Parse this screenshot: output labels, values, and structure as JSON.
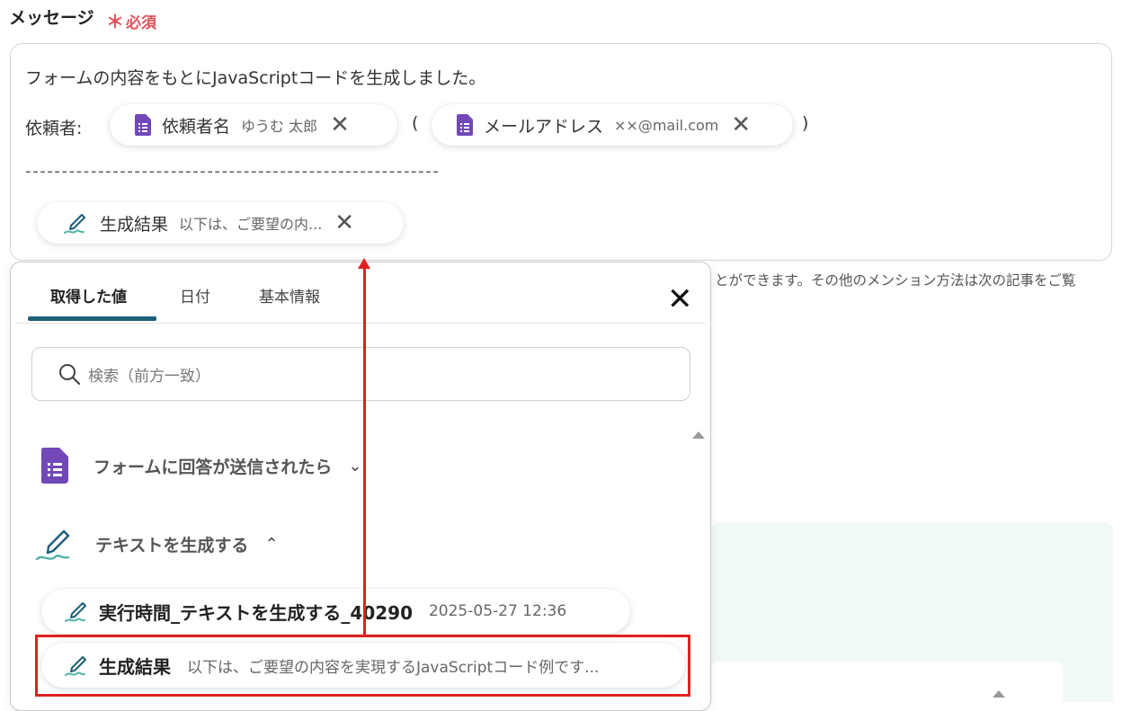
{
  "field": {
    "label": "メッセージ",
    "required_mark": "＊",
    "required_label": "必須"
  },
  "editor": {
    "line1": "フォームの内容をもとにJavaScriptコードを生成しました。",
    "requester_label": "依頼者:",
    "open_paren": "(",
    "close_paren": ")",
    "dashes": "---------------------------------------------------------",
    "chips": [
      {
        "name": "依頼者名",
        "value": "ゆうむ 太郎",
        "icon": "google-forms-icon"
      },
      {
        "name": "メールアドレス",
        "value": "××@mail.com",
        "icon": "google-forms-icon"
      },
      {
        "name": "生成結果",
        "value": "以下は、ご要望の内...",
        "icon": "ai-pen-icon"
      }
    ],
    "remove_glyph": "✕"
  },
  "hint": "とができます。その他のメンション方法は次の記事をご覧",
  "picker": {
    "tabs": [
      "取得した値",
      "日付",
      "基本情報"
    ],
    "active_tab": 0,
    "close_glyph": "✕",
    "search_placeholder": "検索（前方一致）",
    "sections": [
      {
        "title": "フォームに回答が送信されたら",
        "chevron": "⌄",
        "icon": "google-forms-icon",
        "expanded": false
      },
      {
        "title": "テキストを生成する",
        "chevron": "⌃",
        "icon": "ai-pen-icon",
        "expanded": true
      }
    ],
    "items": [
      {
        "name": "実行時間_テキストを生成する_40290",
        "value": "2025-05-27 12:36"
      },
      {
        "name": "生成結果",
        "value": "以下は、ご要望の内容を実現するJavaScriptコード例です..."
      }
    ]
  },
  "colors": {
    "accent": "#1e5f79",
    "forms_purple": "#7248b9",
    "highlight_red": "#e02020",
    "required_red": "#e0525a"
  }
}
